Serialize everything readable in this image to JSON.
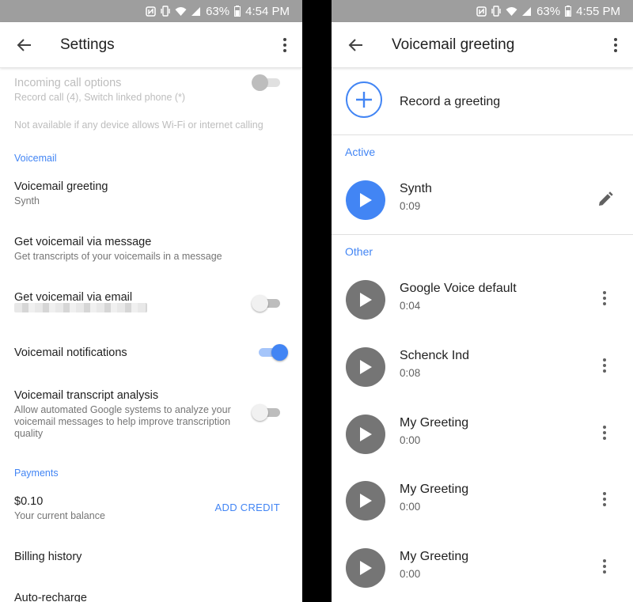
{
  "colors": {
    "accent": "#4285f4",
    "statusbar": "#9e9e9e",
    "play_inactive": "#757575"
  },
  "left": {
    "status": {
      "battery": "63%",
      "time": "4:54 PM"
    },
    "title": "Settings",
    "icons": {
      "back": "back-arrow-icon",
      "more": "more-vert-icon"
    },
    "incoming": {
      "title": "Incoming call options",
      "subtitle": "Record call (4), Switch linked phone (*)",
      "note": "Not available if any device allows Wi-Fi or internet calling",
      "enabled": false
    },
    "voicemail_section": "Voicemail",
    "voicemail_greeting": {
      "title": "Voicemail greeting",
      "subtitle": "Synth"
    },
    "via_message": {
      "title": "Get voicemail via message",
      "subtitle": "Get transcripts of your voicemails in a message"
    },
    "via_email": {
      "title": "Get voicemail via email",
      "enabled": false
    },
    "notifications": {
      "title": "Voicemail notifications",
      "enabled": true
    },
    "transcript": {
      "title": "Voicemail transcript analysis",
      "subtitle_line1": "Allow automated Google systems to analyze your",
      "subtitle_line2": "voicemail messages to help improve transcription",
      "subtitle_line3": "quality",
      "enabled": false
    },
    "payments_section": "Payments",
    "balance": {
      "amount": "$0.10",
      "label": "Your current balance",
      "action": "ADD CREDIT"
    },
    "billing_history": "Billing history",
    "auto_recharge": "Auto-recharge"
  },
  "right": {
    "status": {
      "battery": "63%",
      "time": "4:55 PM"
    },
    "title": "Voicemail greeting",
    "icons": {
      "back": "back-arrow-icon",
      "more": "more-vert-icon",
      "add": "add-circle-icon",
      "play": "play-icon",
      "edit": "pencil-icon"
    },
    "record_label": "Record a greeting",
    "active_section": "Active",
    "active": {
      "name": "Synth",
      "duration": "0:09"
    },
    "other_section": "Other",
    "others": [
      {
        "name": "Google Voice default",
        "duration": "0:04"
      },
      {
        "name": "Schenck Ind",
        "duration": "0:08"
      },
      {
        "name": "My Greeting",
        "duration": "0:00"
      },
      {
        "name": "My Greeting",
        "duration": "0:00"
      },
      {
        "name": "My Greeting",
        "duration": "0:00"
      }
    ]
  }
}
